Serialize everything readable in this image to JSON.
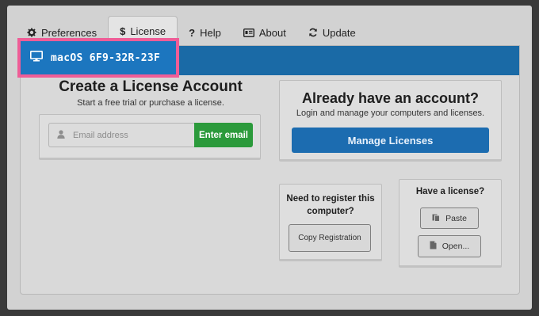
{
  "tabs": [
    {
      "label": "Preferences",
      "icon": "gear-icon",
      "active": false
    },
    {
      "label": "License",
      "icon": "dollar-icon",
      "active": true
    },
    {
      "label": "Help",
      "icon": "question-icon",
      "active": false
    },
    {
      "label": "About",
      "icon": "id-card-icon",
      "active": false
    },
    {
      "label": "Update",
      "icon": "refresh-icon",
      "active": false
    }
  ],
  "machine": {
    "id_text": "macOS 6F9-32R-23F",
    "icon": "monitor-icon"
  },
  "create": {
    "title": "Create a License Account",
    "subtitle": "Start a free trial or purchase a license.",
    "email_placeholder": "Email address",
    "enter_label": "Enter email"
  },
  "account": {
    "title": "Already have an account?",
    "subtitle": "Login and manage your computers and licenses.",
    "manage_label": "Manage Licenses"
  },
  "register": {
    "title": "Need to register this computer?",
    "copy_label": "Copy Registration"
  },
  "license": {
    "title": "Have a license?",
    "paste_label": "Paste",
    "open_label": "Open..."
  },
  "colors": {
    "accent_blue": "#1c6cb0",
    "enter_green": "#2b9a3b",
    "highlight_pink": "#ef5d97"
  }
}
